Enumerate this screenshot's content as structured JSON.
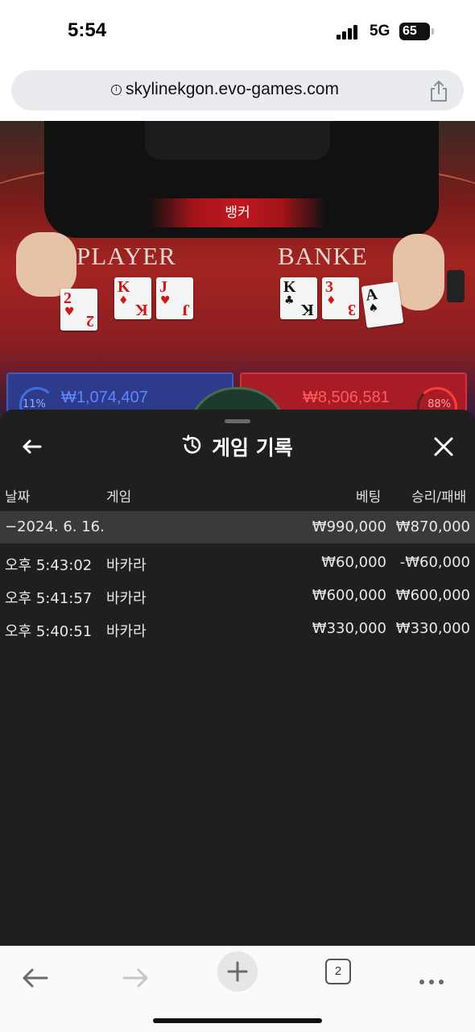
{
  "status_bar": {
    "time": "5:54",
    "network": "5G",
    "battery": "65"
  },
  "browser": {
    "url": "skylinekgon.evo-games.com",
    "tab_count": "2"
  },
  "game": {
    "banner": "뱅커",
    "player_label": "PLAYER",
    "banker_label": "BANKE",
    "player_cards": [
      {
        "rank": "2",
        "suit": "♥",
        "color": "red"
      },
      {
        "rank": "K",
        "suit": "♦",
        "color": "red"
      },
      {
        "rank": "J",
        "suit": "♥",
        "color": "red"
      }
    ],
    "banker_cards": [
      {
        "rank": "K",
        "suit": "♣",
        "color": "black"
      },
      {
        "rank": "3",
        "suit": "♦",
        "color": "red"
      },
      {
        "rank": "A",
        "suit": "♠",
        "color": "black"
      }
    ],
    "player_pct": "11%",
    "player_amount": "₩1,074,407",
    "banker_pct": "88%",
    "banker_amount": "₩8,506,581"
  },
  "history": {
    "title": "게임 기록",
    "columns": {
      "date": "날짜",
      "game": "게임",
      "bet": "베팅",
      "result": "승리/패배"
    },
    "summary": {
      "date": "−2024. 6. 16.",
      "bet": "₩990,000",
      "result": "₩870,000"
    },
    "rows": [
      {
        "time": "오후 5:43:02",
        "game": "바카라",
        "bet": "₩60,000",
        "result": "-₩60,000"
      },
      {
        "time": "오후 5:41:57",
        "game": "바카라",
        "bet": "₩600,000",
        "result": "₩600,000"
      },
      {
        "time": "오후 5:40:51",
        "game": "바카라",
        "bet": "₩330,000",
        "result": "₩330,000"
      }
    ]
  },
  "colors": {
    "sheet_bg": "#1f1f1f",
    "summary_bg": "#3a3a3a",
    "banker_red": "#a81d25",
    "player_blue": "#2e3b8a"
  }
}
